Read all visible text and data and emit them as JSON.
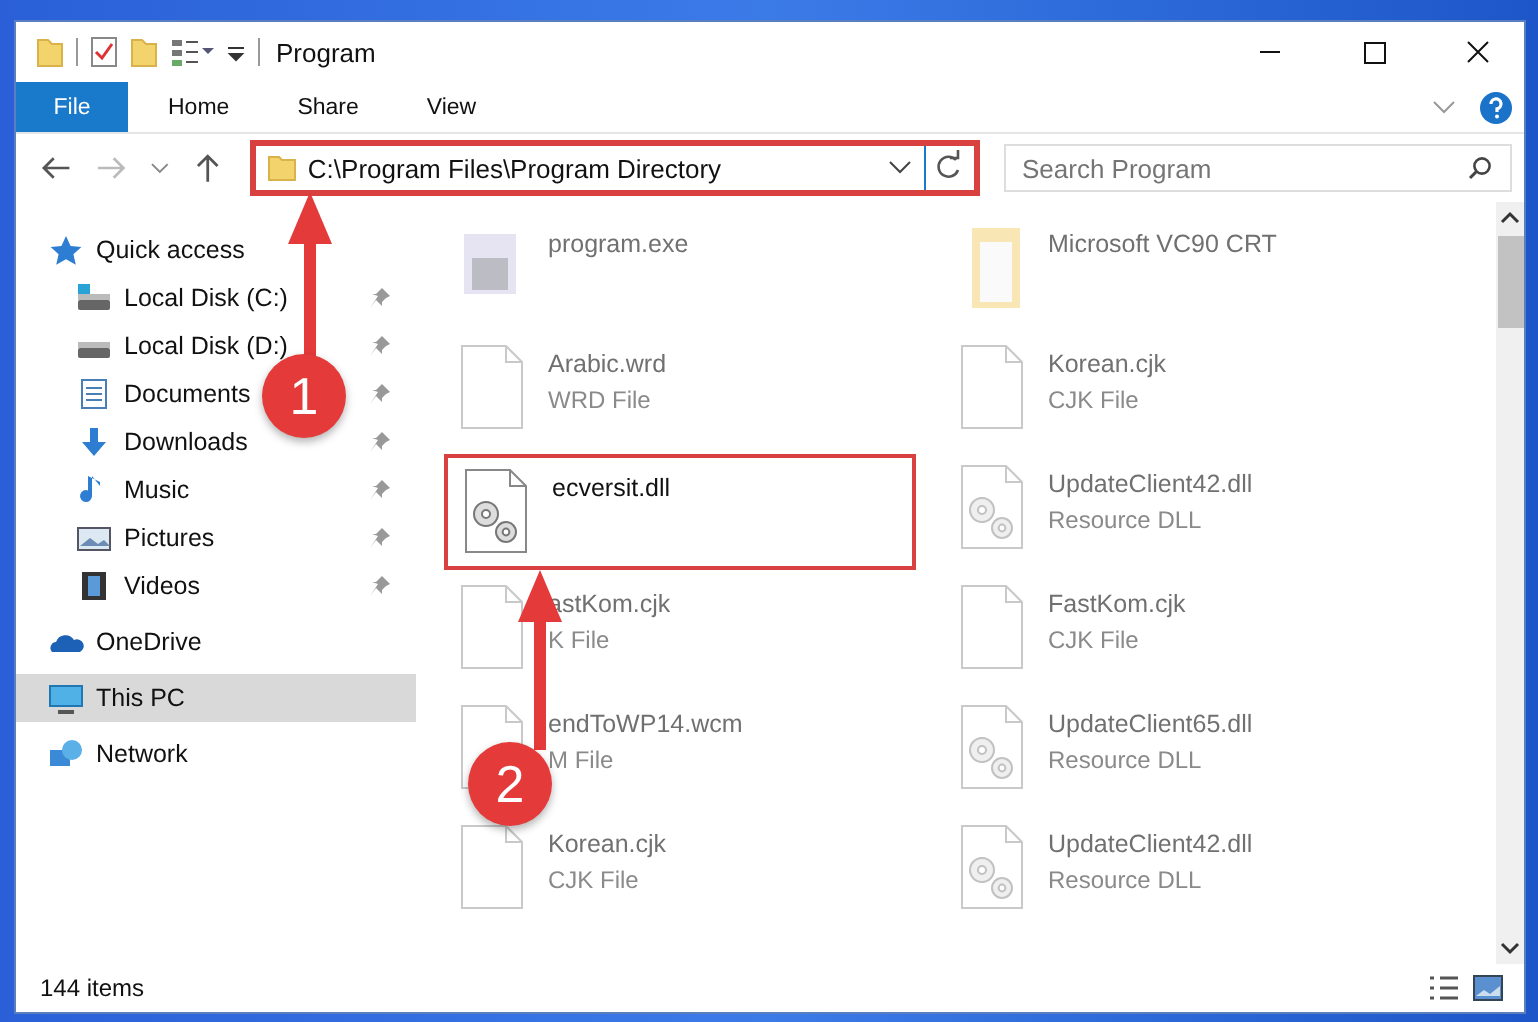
{
  "window": {
    "title": "Program"
  },
  "ribbon": {
    "tabs": [
      {
        "label": "File",
        "selected": true
      },
      {
        "label": "Home",
        "selected": false
      },
      {
        "label": "Share",
        "selected": false
      },
      {
        "label": "View",
        "selected": false
      }
    ]
  },
  "address": {
    "path": "C:\\Program Files\\Program Directory",
    "highlighted": true
  },
  "search": {
    "placeholder": "Search Program"
  },
  "sidebar": {
    "items": [
      {
        "label": "Quick access",
        "kind": "star",
        "selected": false,
        "children": [
          {
            "label": "Local Disk (C:)",
            "kind": "drive-c",
            "pinned": true,
            "selected": false
          },
          {
            "label": "Local Disk (D:)",
            "kind": "drive",
            "pinned": true,
            "selected": false
          },
          {
            "label": "Documents",
            "kind": "documents",
            "pinned": true,
            "selected": false
          },
          {
            "label": "Downloads",
            "kind": "downloads",
            "pinned": true,
            "selected": false
          },
          {
            "label": "Music",
            "kind": "music",
            "pinned": true,
            "selected": false
          },
          {
            "label": "Pictures",
            "kind": "pictures",
            "pinned": true,
            "selected": false
          },
          {
            "label": "Videos",
            "kind": "videos",
            "pinned": true,
            "selected": false
          }
        ]
      },
      {
        "label": "OneDrive",
        "kind": "cloud",
        "selected": false
      },
      {
        "label": "This PC",
        "kind": "pc",
        "selected": true
      },
      {
        "label": "Network",
        "kind": "network",
        "selected": false
      }
    ]
  },
  "files": [
    {
      "name": "program.exe",
      "kind": "exe",
      "dimmed": true,
      "highlighted": false
    },
    {
      "name": "Microsoft VC90 CRT",
      "kind": "folder",
      "dimmed": true,
      "highlighted": false
    },
    {
      "name": "Arabic.wrd",
      "type": "WRD File",
      "kind": "blank",
      "dimmed": true,
      "highlighted": false
    },
    {
      "name": "Korean.cjk",
      "type": "CJK File",
      "kind": "blank",
      "dimmed": true,
      "highlighted": false
    },
    {
      "name": "ecversit.dll",
      "kind": "gear",
      "dimmed": false,
      "highlighted": true
    },
    {
      "name": "UpdateClient42.dll",
      "type": "Resource DLL",
      "kind": "gear",
      "dimmed": true,
      "highlighted": false
    },
    {
      "name": "astKom.cjk",
      "type": "K File",
      "kind": "blank",
      "dimmed": true,
      "highlighted": false
    },
    {
      "name": "FastKom.cjk",
      "type": "CJK File",
      "kind": "blank",
      "dimmed": true,
      "highlighted": false
    },
    {
      "name": "endToWP14.wcm",
      "type": "M File",
      "kind": "blank",
      "dimmed": true,
      "highlighted": false
    },
    {
      "name": "UpdateClient65.dll",
      "type": "Resource DLL",
      "kind": "gear",
      "dimmed": true,
      "highlighted": false
    },
    {
      "name": "Korean.cjk",
      "type": "CJK File",
      "kind": "blank",
      "dimmed": true,
      "highlighted": false
    },
    {
      "name": "UpdateClient42.dll",
      "type": "Resource DLL",
      "kind": "gear",
      "dimmed": true,
      "highlighted": false
    }
  ],
  "status_bar": {
    "count": "144 items"
  },
  "annotations": [
    {
      "label": "1"
    },
    {
      "label": "2"
    }
  ]
}
